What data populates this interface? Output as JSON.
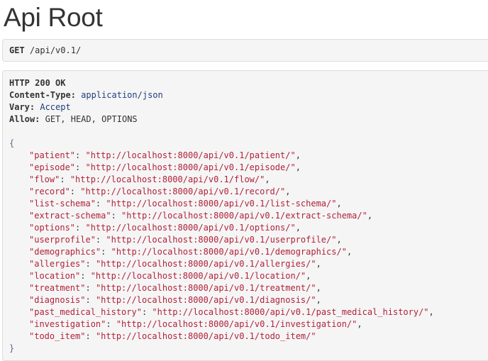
{
  "page": {
    "title": "Api Root"
  },
  "request": {
    "method": "GET",
    "path": "/api/v0.1/"
  },
  "response": {
    "status_line": "HTTP 200 OK",
    "headers": [
      {
        "name": "Content-Type:",
        "value": "application/json",
        "style": "link"
      },
      {
        "name": "Vary:",
        "value": "Accept",
        "style": "link"
      },
      {
        "name": "Allow:",
        "value": "GET, HEAD, OPTIONS",
        "style": "plain"
      }
    ],
    "open_brace": "{",
    "close_brace": "}",
    "entries": [
      {
        "key": "\"patient\"",
        "value": "\"http://localhost:8000/api/v0.1/patient/\""
      },
      {
        "key": "\"episode\"",
        "value": "\"http://localhost:8000/api/v0.1/episode/\""
      },
      {
        "key": "\"flow\"",
        "value": "\"http://localhost:8000/api/v0.1/flow/\""
      },
      {
        "key": "\"record\"",
        "value": "\"http://localhost:8000/api/v0.1/record/\""
      },
      {
        "key": "\"list-schema\"",
        "value": "\"http://localhost:8000/api/v0.1/list-schema/\""
      },
      {
        "key": "\"extract-schema\"",
        "value": "\"http://localhost:8000/api/v0.1/extract-schema/\""
      },
      {
        "key": "\"options\"",
        "value": "\"http://localhost:8000/api/v0.1/options/\""
      },
      {
        "key": "\"userprofile\"",
        "value": "\"http://localhost:8000/api/v0.1/userprofile/\""
      },
      {
        "key": "\"demographics\"",
        "value": "\"http://localhost:8000/api/v0.1/demographics/\""
      },
      {
        "key": "\"allergies\"",
        "value": "\"http://localhost:8000/api/v0.1/allergies/\""
      },
      {
        "key": "\"location\"",
        "value": "\"http://localhost:8000/api/v0.1/location/\""
      },
      {
        "key": "\"treatment\"",
        "value": "\"http://localhost:8000/api/v0.1/treatment/\""
      },
      {
        "key": "\"diagnosis\"",
        "value": "\"http://localhost:8000/api/v0.1/diagnosis/\""
      },
      {
        "key": "\"past_medical_history\"",
        "value": "\"http://localhost:8000/api/v0.1/past_medical_history/\""
      },
      {
        "key": "\"investigation\"",
        "value": "\"http://localhost:8000/api/v0.1/investigation/\""
      },
      {
        "key": "\"todo_item\"",
        "value": "\"http://localhost:8000/api/v0.1/todo_item/\""
      }
    ]
  }
}
